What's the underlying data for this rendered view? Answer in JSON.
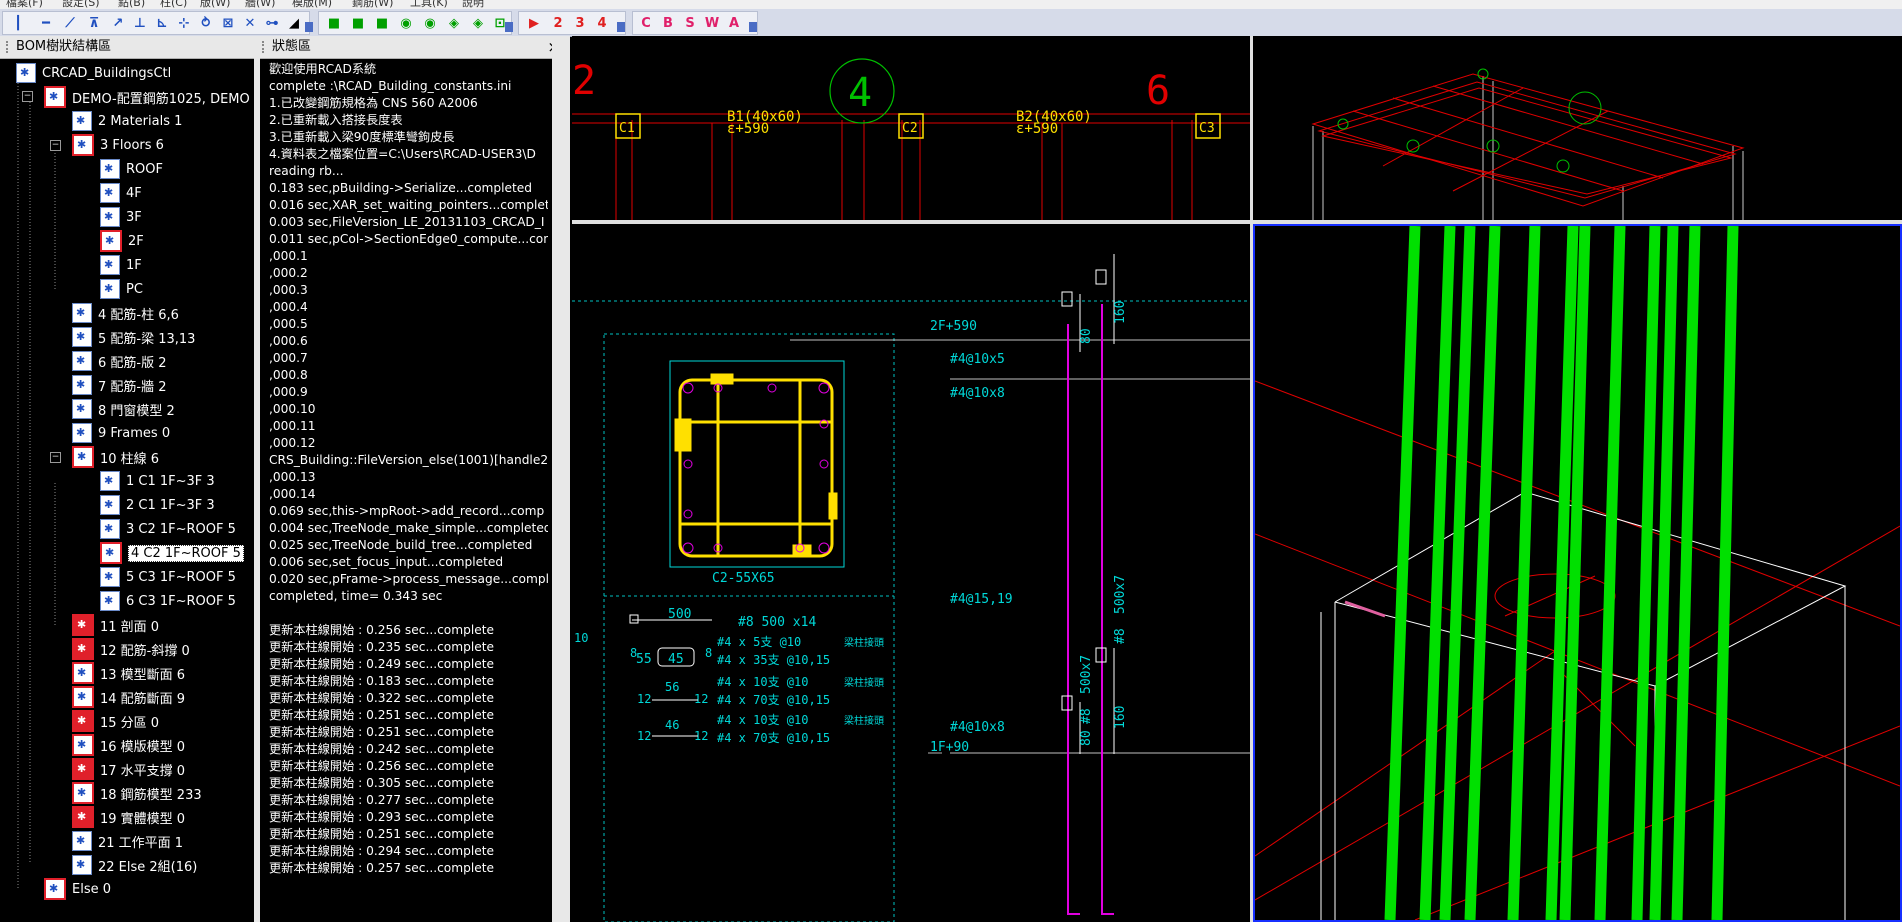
{
  "menubar": {
    "items": [
      "檔案(F)",
      "設定(S)",
      "點(B)",
      "柱(C)",
      "版(W)",
      "牆(W)",
      "模版(M)",
      "鋼筋(W)",
      "工具(K)",
      "說明"
    ]
  },
  "toolbar": {
    "number_buttons": [
      "2",
      "3",
      "4"
    ],
    "letter_buttons": [
      "C",
      "B",
      "S",
      "W",
      "A"
    ]
  },
  "bom_panel": {
    "title": "BOM樹狀結構區"
  },
  "status_panel": {
    "title": "狀態區",
    "close": "×"
  },
  "tree": {
    "root": "CRCAD_BuildingsCtl",
    "demo": "DEMO-配置鋼筋1025, DEMO",
    "items": [
      "2 Materials 1",
      "3 Floors 6",
      "ROOF",
      "4F",
      "3F",
      "2F",
      "1F",
      "PC",
      "4 配筋-柱 6,6",
      "5 配筋-梁 13,13",
      "6 配筋-版 2",
      "7 配筋-牆 2",
      "8 門窗模型 2",
      "9 Frames 0",
      "10 柱線 6",
      "1 C1 1F~3F 3",
      "2 C1 1F~3F 3",
      "3 C2 1F~ROOF 5",
      "4 C2 1F~ROOF 5",
      "5 C3 1F~ROOF 5",
      "6 C3 1F~ROOF 5",
      "11 剖面 0",
      "12 配筋-斜撐 0",
      "13 模型斷面 6",
      "14 配筋斷面 9",
      "15 分區 0",
      "16 模版模型 0",
      "17 水平支撐 0",
      "18 鋼筋模型 233",
      "19 實體模型 0",
      "21 工作平面 1",
      "22 Else 2組(16)",
      "Else 0"
    ]
  },
  "status_lines": [
    "歡迎使用RCAD系統",
    "complete :\\RCAD_Building_constants.ini",
    "1.已改變鋼筋規格為 CNS 560 A2006",
    "2.已重新載入搭接長度表",
    "3.已重新載入梁90度標準彎鉤皮長",
    "4.資料表之檔案位置=C:\\Users\\RCAD-USER3\\D",
    "reading rb...",
    "0.183 sec,pBuilding->Serialize...completed",
    "0.016 sec,XAR_set_waiting_pointers...complete",
    "0.003 sec,FileVersion_LE_20131103_CRCAD_I",
    "0.011 sec,pCol->SectionEdge0_compute...con",
    ",000.1",
    ",000.2",
    ",000.3",
    ",000.4",
    ",000.5",
    ",000.6",
    ",000.7",
    ",000.8",
    ",000.9",
    ",000.10",
    ",000.11",
    ",000.12",
    "CRS_Building::FileVersion_else(1001)[handle2]",
    ",000.13",
    ",000.14",
    "0.069 sec,this->mpRoot->add_record...comp",
    "0.004 sec,TreeNode_make_simple...completed",
    "0.025 sec,TreeNode_build_tree...completed",
    "0.006 sec,set_focus_input...completed",
    "0.020 sec,pFrame->process_message...compl",
    "  completed, time= 0.343 sec",
    "",
    "更新本柱線開始 : 0.256 sec...complete",
    "更新本柱線開始 : 0.235 sec...complete",
    "更新本柱線開始 : 0.249 sec...complete",
    "更新本柱線開始 : 0.183 sec...complete",
    "更新本柱線開始 : 0.322 sec...complete",
    "更新本柱線開始 : 0.251 sec...complete",
    "更新本柱線開始 : 0.251 sec...complete",
    "更新本柱線開始 : 0.242 sec...complete",
    "更新本柱線開始 : 0.256 sec...complete",
    "更新本柱線開始 : 0.305 sec...complete",
    "更新本柱線開始 : 0.277 sec...complete",
    "更新本柱線開始 : 0.293 sec...complete",
    "更新本柱線開始 : 0.251 sec...complete",
    "更新本柱線開始 : 0.294 sec...complete",
    "更新本柱線開始 : 0.257 sec...complete"
  ],
  "plan_view": {
    "grid_labels": [
      "2",
      "4",
      "6"
    ],
    "columns": [
      "C1",
      "C2",
      "C3"
    ],
    "beams": [
      {
        "name": "B1(40x60)",
        "elev": "ε+590"
      },
      {
        "name": "B2(40x60)",
        "elev": "ε+590"
      }
    ]
  },
  "detail_view": {
    "section_label": "C2-55X65",
    "bar_500": "500",
    "bar_main": "#8  500  x14",
    "side_10": "10",
    "side_8a": "8",
    "side_8b": "8",
    "dim_55": "55",
    "dim_45": "45",
    "dim_56": "56",
    "dim_46": "46",
    "dim_12a": "12",
    "dim_12b": "12",
    "dim_12c": "12",
    "dim_12d": "12",
    "stirrup_rows": [
      {
        "text": "#4  x   5支  @10",
        "note": "梁柱接頭"
      },
      {
        "text": "#4  x  35支  @10,15",
        "note": ""
      },
      {
        "text": "#4  x  10支  @10",
        "note": "梁柱接頭"
      },
      {
        "text": "#4  x  70支  @10,15",
        "note": ""
      },
      {
        "text": "#4  x  10支  @10",
        "note": "梁柱接頭"
      },
      {
        "text": "#4  x  70支  @10,15",
        "note": ""
      }
    ],
    "elev_2f": "2F+590",
    "elev_1f": "1F+90",
    "rebar_notes": [
      "#4@10x5",
      "#4@10x8",
      "#4@15,19",
      "#4@10x8"
    ],
    "dims_vertical": [
      "160",
      "80",
      "500x7",
      "#8",
      "500x7",
      "#8",
      "160",
      "80"
    ]
  },
  "colors": {
    "green_rebar": "#00e000",
    "red_lines": "#e00000",
    "cyan": "#00d8d8",
    "yellow": "#ffe000",
    "magenta": "#e000e0",
    "active_border": "#1830ff"
  }
}
